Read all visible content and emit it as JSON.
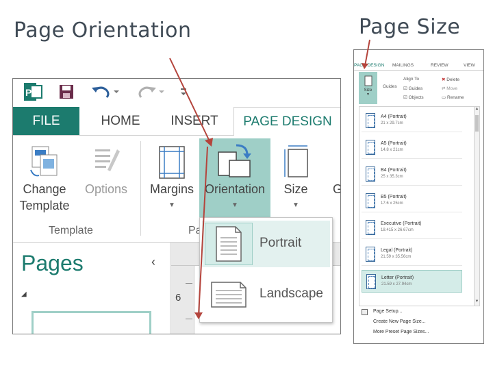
{
  "titles": {
    "left": "Page Orientation",
    "right": "Page Size"
  },
  "left": {
    "qat": {
      "app_icon": "publisher-icon",
      "save_icon": "save-icon",
      "undo_icon": "undo-icon",
      "redo_icon": "redo-icon",
      "customize_icon": "customize-qat-icon"
    },
    "tabs": [
      "FILE",
      "HOME",
      "INSERT",
      "PAGE DESIGN"
    ],
    "active_tab": "PAGE DESIGN",
    "ribbon": {
      "change_template_line1": "Change",
      "change_template_line2": "Template",
      "options": "Options",
      "margins": "Margins",
      "orientation": "Orientation",
      "size": "Size",
      "next_cut": "G",
      "group_template": "Template",
      "group_page_setup_cut": "Pa"
    },
    "pages_pane": {
      "title": "Pages",
      "collapse": "‹"
    },
    "ruler": {
      "vertical_number": "6"
    },
    "orientation_menu": {
      "items": [
        "Portrait",
        "Landscape"
      ],
      "selected": "Portrait"
    }
  },
  "right": {
    "tabs": [
      "PAGE DESIGN",
      "MAILINGS",
      "REVIEW",
      "VIEW"
    ],
    "ribbon": {
      "size": "Size",
      "guides": "Guides",
      "align_to": "Align To",
      "guides_check": "Guides",
      "objects_check": "Objects",
      "delete": "Delete",
      "move": "Move",
      "rename": "Rename"
    },
    "page_sizes": [
      {
        "name": "A4 (Portrait)",
        "dim": "21 x 29.7cm"
      },
      {
        "name": "A5 (Portrait)",
        "dim": "14.8 x 21cm"
      },
      {
        "name": "B4 (Portrait)",
        "dim": "25 x 35.3cm"
      },
      {
        "name": "B5 (Portrait)",
        "dim": "17.6 x 25cm"
      },
      {
        "name": "Executive (Portrait)",
        "dim": "18.415 x 26.67cm"
      },
      {
        "name": "Legal (Portrait)",
        "dim": "21.59 x 35.56cm"
      },
      {
        "name": "Letter (Portrait)",
        "dim": "21.59 x 27.94cm"
      }
    ],
    "selected_size": "Letter (Portrait)",
    "footer_links": [
      "Page Setup...",
      "Create New Page Size...",
      "More Preset Page Sizes..."
    ]
  },
  "colors": {
    "accent": "#1c7b6e",
    "highlight": "#9fcfc7",
    "arrow": "#b4443c"
  }
}
